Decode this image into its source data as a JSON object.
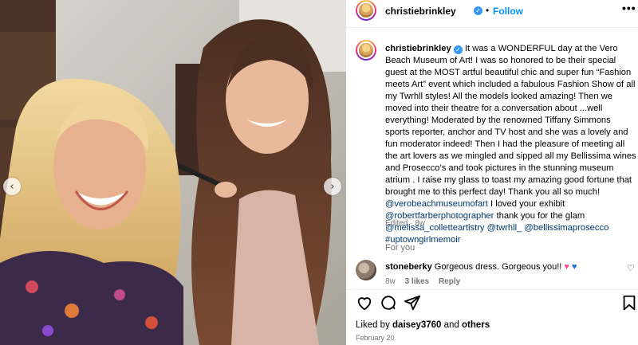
{
  "post": {
    "username": "christiebrinkley",
    "follow_label": "Follow",
    "dot": "•",
    "more": "•••",
    "caption_lines": [
      "It was a WONDERFUL day at the Vero Beach Museum of Art! I was so honored to be their special guest at the MOST artful beautiful chic and super fun “Fashion meets Art” event which included a fabulous Fashion Show of all my Twrhll styles! All the models looked amazing! Then we moved into their theatre for a conversation about ...well everything! Moderated by the renowned Tiffany Simmons sports reporter, anchor and TV host and she was a lovely and fun moderator indeed! Then I had the pleasure of meeting all the art lovers as we mingled and sipped all my Bellissima wines and Prosecco’s and took pictures in the stunning museum atrium . I raise my glass to toast my amazing good fortune that brought me to this perfect day! Thank you all so much!"
    ],
    "mention_vbmoa": "@verobeachmuseumofart",
    "text_loved": " I loved your exhibit",
    "mention_farber": "@robertfarberphotographer",
    "text_glam": " thank you for the glam",
    "mention_melissa": "@melissa_colletteartistry",
    "mention_twrhll": "@twrhll_",
    "mention_bellissima": "@bellissimaprosecco",
    "hashtag": "#uptowngirlmemoir",
    "edited": "Edited · 8w",
    "for_you": "For you",
    "comment": {
      "username": "stoneberky",
      "text": " Gorgeous dress. Gorgeous you!! ",
      "age": "8w",
      "likes": "3 likes",
      "reply": "Reply"
    },
    "liked_by_prefix": "Liked by ",
    "liked_by_user": "daisey3760",
    "liked_by_and": " and ",
    "liked_by_others": "others",
    "date": "February 20"
  },
  "icons": {
    "verified": "✓",
    "prev": "‹",
    "next": "›",
    "heart_pink": "♥",
    "heart_blue": "♥",
    "comment_like": "♡"
  },
  "colors": {
    "accent": "#0095f6",
    "link": "#00376b",
    "muted": "#737373",
    "verified": "#3897f0"
  }
}
